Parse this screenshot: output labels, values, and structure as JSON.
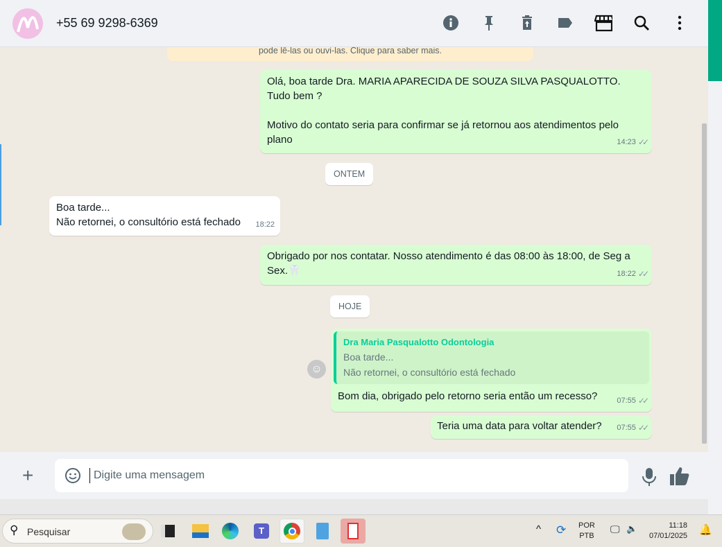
{
  "header": {
    "contact": "+55 69 9298-6369",
    "icons": [
      "info-icon",
      "pin-icon",
      "delete-icon",
      "label-icon",
      "catalog-icon",
      "search-icon",
      "menu-icon"
    ]
  },
  "chat": {
    "notice": "pode lê-las ou ouvi-las. Clique para saber mais.",
    "messages": [
      {
        "line1": "Olá, boa tarde Dra. MARIA APARECIDA DE SOUZA SILVA PASQUALOTTO. Tudo bem ?",
        "line2": "Motivo do contato seria para confirmar se já retornou aos atendimentos pelo plano",
        "time": "14:23"
      },
      {
        "time": "18:22",
        "line1": "Boa tarde...",
        "line2": "Não retornei, o consultório está fechado"
      },
      {
        "line1": "Obrigado por nos contatar. Nosso atendimento é das 08:00 às 18:00, de Seg a Sex.🦷",
        "time": "18:22"
      },
      {
        "quote_author": "Dra Maria Pasqualotto Odontologia",
        "quote_line1": "Boa tarde...",
        "quote_line2": "Não retornei, o consultório está fechado",
        "text": "Bom dia, obrigado pelo retorno seria então um recesso?",
        "time": "07:55"
      },
      {
        "text": "Teria uma data para voltar atender?",
        "time": "07:55"
      }
    ],
    "dates": {
      "yesterday": "ONTEM",
      "today": "HOJE"
    },
    "ticks": "✓✓"
  },
  "footer": {
    "placeholder": "Digite uma mensagem"
  },
  "taskbar": {
    "search": "Pesquisar",
    "lang1": "POR",
    "lang2": "PTB",
    "time": "11:18",
    "date": "07/01/2025"
  },
  "colors": {
    "accent": "#00a884",
    "outgoing": "#d9fdd3"
  }
}
